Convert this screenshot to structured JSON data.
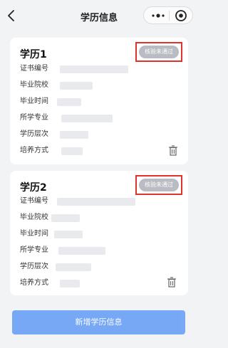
{
  "nav": {
    "title": "学历信息"
  },
  "records": [
    {
      "title": "学历1",
      "status": "核验未通过",
      "fields": [
        "证书编号",
        "毕业院校",
        "毕业时间",
        "所学专业",
        "学历层次",
        "培养方式"
      ]
    },
    {
      "title": "学历2",
      "status": "核验未通过",
      "fields": [
        "证书编号",
        "毕业院校",
        "毕业时间",
        "所学专业",
        "学历层次",
        "培养方式"
      ]
    }
  ],
  "add_button": {
    "label": "新增学历信息"
  },
  "colors": {
    "accent": "#4f8ff7",
    "badge": "#b9bcc2",
    "highlight": "#e0322e",
    "page_bg": "#f2f3f5"
  },
  "icons": [
    "back-icon",
    "more-dots-icon",
    "close-target-icon",
    "trash-icon"
  ]
}
